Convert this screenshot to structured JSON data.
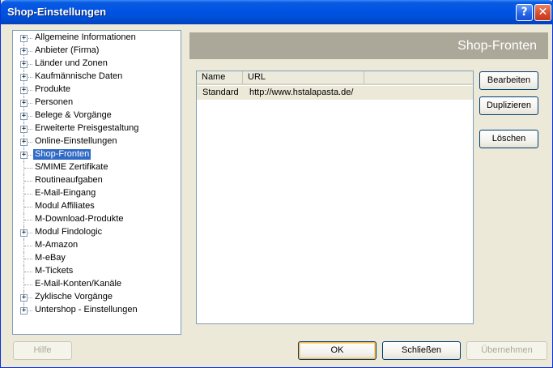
{
  "window": {
    "title": "Shop-Einstellungen",
    "help_glyph": "?",
    "close_glyph": "✕"
  },
  "tree": {
    "items": [
      {
        "label": "Allgemeine Informationen",
        "expandable": true
      },
      {
        "label": "Anbieter (Firma)",
        "expandable": true
      },
      {
        "label": "Länder und Zonen",
        "expandable": true
      },
      {
        "label": "Kaufmännische Daten",
        "expandable": true
      },
      {
        "label": "Produkte",
        "expandable": true
      },
      {
        "label": "Personen",
        "expandable": true
      },
      {
        "label": "Belege & Vorgänge",
        "expandable": true
      },
      {
        "label": "Erweiterte Preisgestaltung",
        "expandable": true
      },
      {
        "label": "Online-Einstellungen",
        "expandable": true
      },
      {
        "label": "Shop-Fronten",
        "expandable": true,
        "selected": true
      },
      {
        "label": "S/MIME Zertifikate",
        "expandable": false
      },
      {
        "label": "Routineaufgaben",
        "expandable": false
      },
      {
        "label": "E-Mail-Eingang",
        "expandable": false
      },
      {
        "label": "Modul Affiliates",
        "expandable": false
      },
      {
        "label": "M-Download-Produkte",
        "expandable": false
      },
      {
        "label": "Modul Findologic",
        "expandable": true
      },
      {
        "label": "M-Amazon",
        "expandable": false
      },
      {
        "label": "M-eBay",
        "expandable": false
      },
      {
        "label": "M-Tickets",
        "expandable": false
      },
      {
        "label": "E-Mail-Konten/Kanäle",
        "expandable": false
      },
      {
        "label": "Zyklische Vorgänge",
        "expandable": true
      },
      {
        "label": "Untershop - Einstellungen",
        "expandable": true
      }
    ]
  },
  "panel": {
    "header": "Shop-Fronten",
    "columns": [
      "Name",
      "URL"
    ],
    "rows": [
      {
        "name": "Standard",
        "url": "http://www.hstalapasta.de/"
      }
    ]
  },
  "side_buttons": {
    "edit": "Bearbeiten",
    "duplicate": "Duplizieren",
    "delete": "Löschen"
  },
  "footer": {
    "help": "Hilfe",
    "ok": "OK",
    "close": "Schließen",
    "apply": "Übernehmen"
  }
}
